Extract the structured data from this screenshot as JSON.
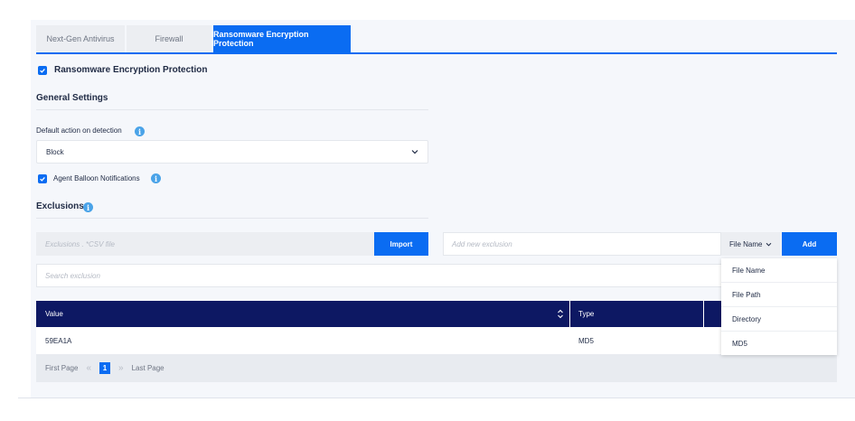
{
  "tabs": [
    {
      "label": "Next-Gen Antivirus"
    },
    {
      "label": "Firewall"
    },
    {
      "label": "Ransomware Encryption Protection",
      "active": true
    }
  ],
  "protection": {
    "label": "Ransomware Encryption Protection",
    "checked": true
  },
  "general": {
    "title": "General Settings",
    "default_action_label": "Default action on detection",
    "default_action_value": "Block",
    "balloon_label": "Agent Balloon Notifications",
    "balloon_checked": true
  },
  "exclusions": {
    "title": "Exclusions",
    "csv_placeholder": "Exclusions . *CSV file",
    "import_label": "Import",
    "new_placeholder": "Add new exclusion",
    "type_selected": "File Name",
    "add_label": "Add",
    "search_placeholder": "Search exclusion",
    "type_options": [
      "File Name",
      "File Path",
      "Directory",
      "MD5"
    ]
  },
  "table": {
    "columns": [
      "Value",
      "Type"
    ],
    "rows": [
      {
        "value": "59EA1A",
        "type": "MD5"
      }
    ]
  },
  "pager": {
    "first_label": "First Page",
    "current_page": "1",
    "last_label": "Last Page"
  },
  "colors": {
    "accent": "#0a6cf2",
    "table_header": "#0d1863",
    "info_icon": "#4aa3e8"
  }
}
